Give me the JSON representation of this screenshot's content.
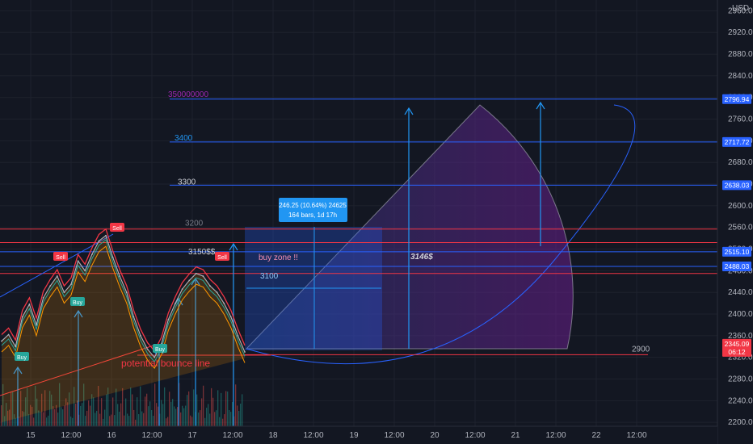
{
  "chart_data": {
    "type": "line",
    "currency_label": "USD",
    "y_axis": {
      "min": 2160,
      "max": 2980,
      "scale": "linear",
      "ticks": [
        2960,
        2920,
        2880,
        2840,
        2800,
        2760,
        2720,
        2680,
        2640,
        2600,
        2560,
        2520,
        2480,
        2440,
        2400,
        2360,
        2320,
        2280,
        2240,
        2200
      ],
      "tick_labels": [
        "2960.00",
        "2920.00",
        "2880.00",
        "2840.00",
        "2800.00",
        "2760.00",
        "2720.00",
        "2680.00",
        "2640.00",
        "2600.00",
        "2560.00",
        "2520.00",
        "2480.00",
        "2440.00",
        "2400.00",
        "2360.00",
        "2320.00",
        "2280.00",
        "2240.00",
        "2200.00"
      ]
    },
    "x_axis": {
      "tick_labels": [
        "15",
        "12:00",
        "16",
        "12:00",
        "17",
        "12:00",
        "18",
        "12:00",
        "19",
        "12:00",
        "20",
        "12:00",
        "21",
        "12:00",
        "22",
        "12:00"
      ]
    },
    "price_series": [
      2350,
      2362,
      2340,
      2395,
      2418,
      2380,
      2430,
      2452,
      2470,
      2440,
      2455,
      2498,
      2480,
      2510,
      2535,
      2545,
      2505,
      2470,
      2440,
      2395,
      2360,
      2335,
      2320,
      2345,
      2390,
      2420,
      2446,
      2462,
      2475,
      2470,
      2452,
      2440,
      2420,
      2395,
      2360,
      2330
    ],
    "horizontal_levels": [
      {
        "label": "350000000",
        "price": 2796.94,
        "color": "#2962ff",
        "price_label": "2796.94"
      },
      {
        "label": "3400",
        "price": 2717.72,
        "color": "#2962ff",
        "price_label": "2717.72"
      },
      {
        "label": "3300",
        "price": 2638.03,
        "color": "#2962ff",
        "price_label": "2638.03"
      },
      {
        "label": "3200",
        "price": 2557,
        "color": "#f23645",
        "price_label": ""
      },
      {
        "label": "",
        "price": 2532,
        "color": "#f23645",
        "price_label": ""
      },
      {
        "label": "3150$$",
        "price": 2515.1,
        "color": "#2962ff",
        "price_label": "2515.10"
      },
      {
        "label": "",
        "price": 2488.03,
        "color": "#2962ff",
        "price_label": "2488.03"
      },
      {
        "label": "",
        "price": 2475,
        "color": "#f23645",
        "price_label": ""
      },
      {
        "label": "2900",
        "price": 2325,
        "color": "#f23645",
        "price_label": ""
      }
    ],
    "current_price": {
      "value": "2345.09",
      "countdown": "06:12",
      "color": "#f23645"
    },
    "measure_tooltip": {
      "line1": "246.25 (10.64%) 24625",
      "line2": "164 bars, 1d 17h"
    },
    "annotations": {
      "buy_zone": "buy zone !!",
      "level_3100": "3100",
      "target_3146": "3146$",
      "bounce_line": "potential bounce line"
    },
    "signals": [
      {
        "type": "Sell",
        "price": 2560
      },
      {
        "type": "Sell",
        "price": 2505
      },
      {
        "type": "Sell",
        "price": 2505
      },
      {
        "type": "Buy",
        "price": 2395
      },
      {
        "type": "Buy",
        "price": 2318
      },
      {
        "type": "Buy",
        "price": 2325
      }
    ],
    "colors": {
      "background": "#131722",
      "bull": "#26a69a",
      "bear": "#ef5350",
      "accent_blue": "#2962ff",
      "fib_fill": "#9c27b0",
      "cloud_fill": "#ff9800"
    }
  }
}
